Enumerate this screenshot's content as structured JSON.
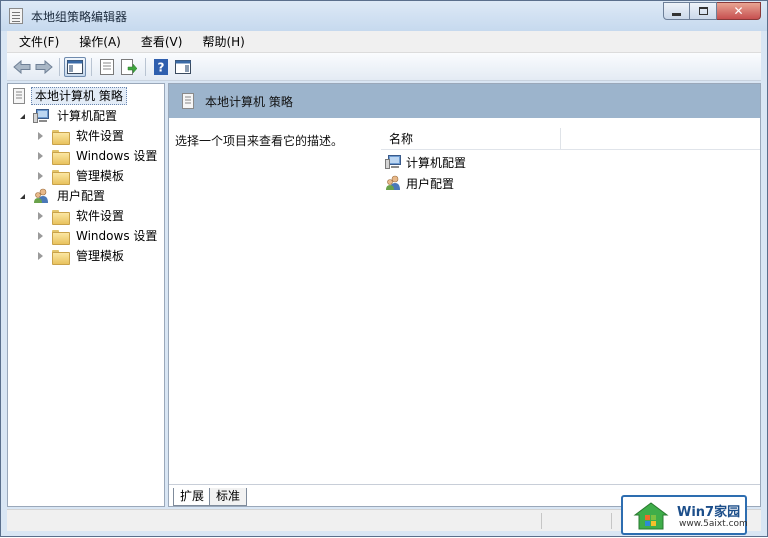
{
  "window": {
    "title": "本地组策略编辑器",
    "minimize_icon": "minimize-icon",
    "maximize_icon": "maximize-icon",
    "close_label": "✕"
  },
  "menu": {
    "items": [
      "文件(F)",
      "操作(A)",
      "查看(V)",
      "帮助(H)"
    ]
  },
  "toolbar": {
    "icons": [
      "back-arrow-icon",
      "forward-arrow-icon",
      "show-hide-console-tree-icon",
      "properties-icon",
      "export-list-icon",
      "help-icon",
      "show-hide-action-pane-icon"
    ]
  },
  "tree": {
    "root": "本地计算机 策略",
    "groups": [
      {
        "label": "计算机配置",
        "children": [
          "软件设置",
          "Windows 设置",
          "管理模板"
        ]
      },
      {
        "label": "用户配置",
        "children": [
          "软件设置",
          "Windows 设置",
          "管理模板"
        ]
      }
    ]
  },
  "right": {
    "header_title": "本地计算机 策略",
    "description": "选择一个项目来查看它的描述。",
    "column_name": "名称",
    "items": [
      "计算机配置",
      "用户配置"
    ]
  },
  "tabs": [
    "扩展",
    "标准"
  ],
  "watermark": {
    "title": "Win7家园",
    "url": "www.5aixt.com"
  },
  "colors": {
    "header_bg": "#9cb4cc",
    "titlebar": "#c6d9ee",
    "close_button": "#c75050"
  }
}
